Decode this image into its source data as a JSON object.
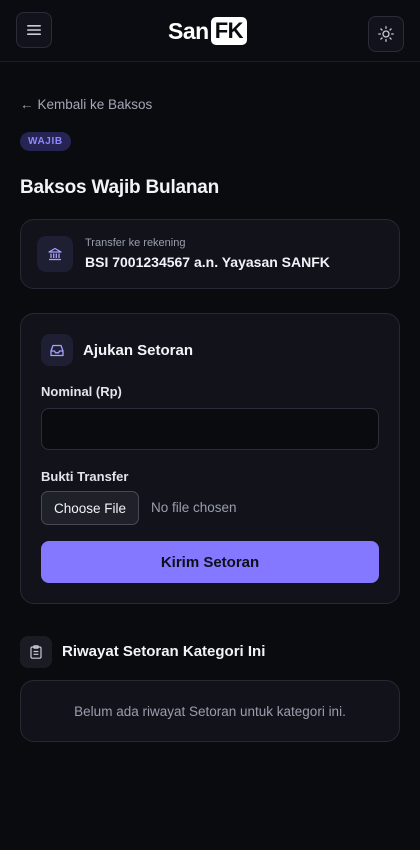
{
  "header": {
    "logo_text": "San",
    "logo_box": "FK",
    "menu_icon": "hamburger-menu-icon",
    "theme_icon": "sun-icon"
  },
  "back_link": {
    "arrow": "←",
    "label": "Kembali ke Baksos"
  },
  "badge": "WAJIB",
  "page_title": "Baksos Wajib Bulanan",
  "bank": {
    "icon": "bank-icon",
    "label": "Transfer ke rekening",
    "value": "BSI 7001234567 a.n. Yayasan SANFK"
  },
  "form": {
    "icon": "inbox-icon",
    "title": "Ajukan Setoran",
    "nominal_label": "Nominal (Rp)",
    "nominal_value": "",
    "bukti_label": "Bukti Transfer",
    "file_button": "Choose File",
    "file_status": "No file chosen",
    "submit_label": "Kirim Setoran"
  },
  "history": {
    "icon": "clipboard-icon",
    "title": "Riwayat Setoran Kategori Ini",
    "empty_text": "Belum ada riwayat Setoran untuk kategori ini."
  },
  "colors": {
    "background": "#0a0b0f",
    "card": "#12131a",
    "accent": "#8378ff",
    "badge_bg": "#262452",
    "badge_text": "#8f86ff"
  }
}
